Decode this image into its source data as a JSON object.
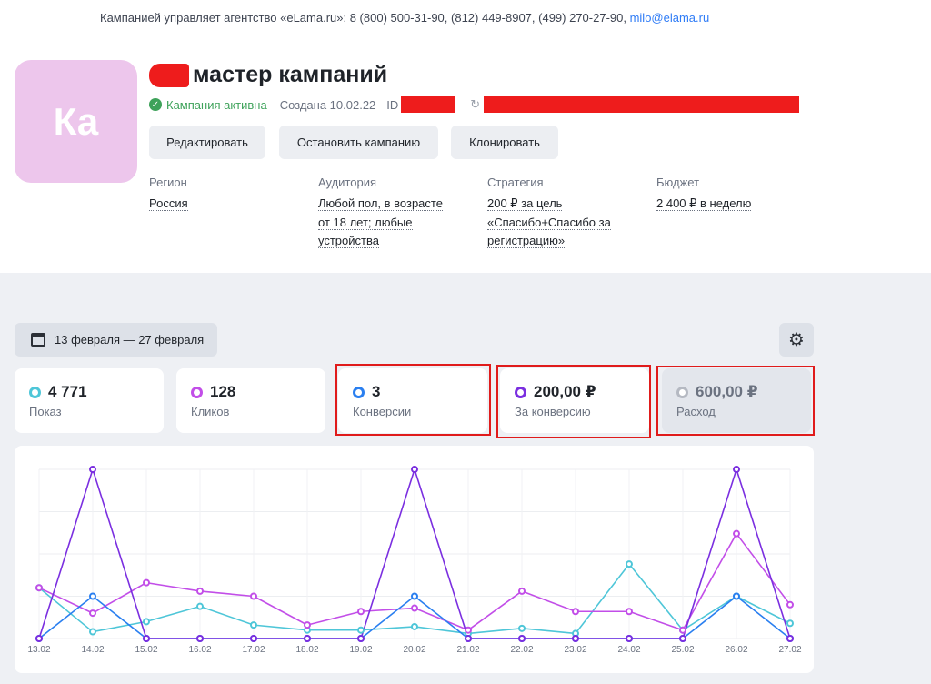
{
  "topbar": {
    "text": "Кампанией управляет агентство «eLama.ru»: 8 (800) 500-31-90, (812) 449-8907, (499) 270-27-90, ",
    "email": "milo@elama.ru"
  },
  "campaign": {
    "avatar": "Ка",
    "title": "мастер кампаний",
    "status": "Кампания активна",
    "created": "Создана 10.02.22",
    "id_label": "ID"
  },
  "actions": {
    "edit": "Редактировать",
    "stop": "Остановить кампанию",
    "clone": "Клонировать"
  },
  "info": {
    "region": {
      "label": "Регион",
      "lines": [
        "Россия"
      ]
    },
    "audience": {
      "label": "Аудитория",
      "lines": [
        "Любой пол, в возрасте",
        "от 18 лет; любые",
        "устройства"
      ]
    },
    "strategy": {
      "label": "Стратегия",
      "lines": [
        "200 ₽ за цель",
        "«Спасибо+Спасибо за",
        "регистрацию»"
      ]
    },
    "budget": {
      "label": "Бюджет",
      "lines": [
        "2 400 ₽ в неделю"
      ]
    }
  },
  "period": {
    "label": "13 февраля — 27 февраля"
  },
  "metrics": [
    {
      "value": "4 771",
      "label": "Показ",
      "color": "#4ec6d8"
    },
    {
      "value": "128",
      "label": "Кликов",
      "color": "#c24ee8"
    },
    {
      "value": "3",
      "label": "Конверсии",
      "color": "#2a7ff0"
    },
    {
      "value": "200,00 ₽",
      "label": "За конверсию",
      "color": "#7b2fe0"
    },
    {
      "value": "600,00 ₽",
      "label": "Расход",
      "color": "#b5b9c2"
    }
  ],
  "chart_data": {
    "type": "line",
    "x": [
      "13.02",
      "14.02",
      "15.02",
      "16.02",
      "17.02",
      "18.02",
      "19.02",
      "20.02",
      "21.02",
      "22.02",
      "23.02",
      "24.02",
      "25.02",
      "26.02",
      "27.02"
    ],
    "ylim": [
      0,
      100
    ],
    "series": [
      {
        "color": "#4ec6d8",
        "values": [
          30,
          4,
          10,
          19,
          8,
          5,
          5,
          7,
          3,
          6,
          3,
          44,
          5,
          25,
          9
        ]
      },
      {
        "color": "#c24ee8",
        "values": [
          30,
          15,
          33,
          28,
          25,
          8,
          16,
          18,
          5,
          28,
          16,
          16,
          5,
          62,
          20
        ]
      },
      {
        "color": "#2a7ff0",
        "values": [
          0,
          25,
          0,
          0,
          0,
          0,
          0,
          25,
          0,
          0,
          0,
          0,
          0,
          25,
          0
        ]
      },
      {
        "color": "#7b2fe0",
        "values": [
          0,
          100,
          0,
          0,
          0,
          0,
          0,
          100,
          0,
          0,
          0,
          0,
          0,
          100,
          0
        ]
      }
    ]
  }
}
